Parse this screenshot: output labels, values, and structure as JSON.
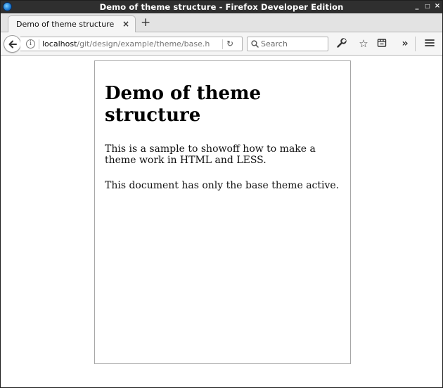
{
  "window": {
    "title": "Demo of theme structure - Firefox Developer Edition",
    "controls": {
      "minimize": "_",
      "maximize": "□",
      "close": "×"
    }
  },
  "tabs": [
    {
      "label": "Demo of theme structure",
      "close": "×",
      "active": true
    }
  ],
  "new_tab": "+",
  "navbar": {
    "url_host": "localhost",
    "url_path": "/git/design/example/theme/base.h",
    "info_glyph": "i",
    "reload_glyph": "↻",
    "search_placeholder": "Search",
    "overflow_glyph": "»",
    "star_glyph": "☆",
    "icons": [
      "back-arrow-icon",
      "info-icon",
      "reload-icon",
      "search-icon",
      "wrench-icon",
      "bookmark-star-icon",
      "pocket-icon",
      "overflow-chevron-icon",
      "hamburger-menu-icon"
    ]
  },
  "page": {
    "heading": "Demo of theme structure",
    "paragraphs": [
      "This is a sample to showoff how to make a theme work in HTML and LESS.",
      "This document has only the base theme active."
    ]
  },
  "colors": {
    "titlebar": "#2f2f2f",
    "toolbar": "#f5f5f5",
    "tabstrip": "#e3e3e3",
    "page_border": "#a7a7a7"
  }
}
